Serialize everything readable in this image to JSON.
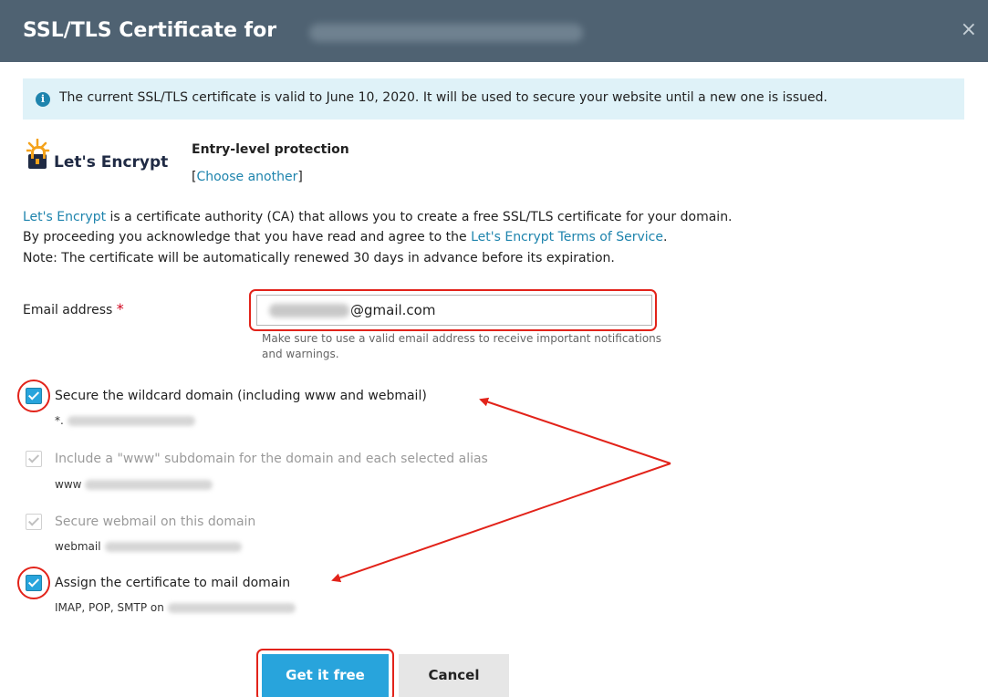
{
  "dialog": {
    "title": "SSL/TLS Certificate for",
    "close_glyph": "×"
  },
  "info": {
    "icon": "info-icon",
    "icon_glyph": "i",
    "text": "The current SSL/TLS certificate is valid to June 10, 2020. It will be used to secure your website until a new one is issued."
  },
  "provider": {
    "logo_text": "Let's Encrypt",
    "protection": "Entry-level protection",
    "choose_link": "Choose another",
    "bracket_open": "[",
    "bracket_close": "]"
  },
  "description": {
    "line1_link": "Let's Encrypt",
    "line1_rest": " is a certificate authority (CA) that allows you to create a free SSL/TLS certificate for your domain.",
    "line2_prefix": "By proceeding you acknowledge that you have read and agree to the ",
    "line2_link": "Let's Encrypt Terms of Service",
    "line2_suffix": ".",
    "line3": "Note: The certificate will be automatically renewed 30 days in advance before its expiration."
  },
  "email": {
    "label": "Email address",
    "required_mark": "*",
    "value": "@gmail.com",
    "hint": "Make sure to use a valid email address to receive important notifications and warnings."
  },
  "options": [
    {
      "label": "Secure the wildcard domain (including www and webmail)",
      "sub": "*.",
      "checked": true,
      "enabled": true
    },
    {
      "label": "Include a \"www\" subdomain for the domain and each selected alias",
      "sub": "www",
      "checked": true,
      "enabled": false
    },
    {
      "label": "Secure webmail on this domain",
      "sub": "webmail",
      "checked": true,
      "enabled": false
    },
    {
      "label": "Assign the certificate to mail domain",
      "sub": "IMAP, POP, SMTP on",
      "checked": true,
      "enabled": true
    }
  ],
  "buttons": {
    "primary": "Get it free",
    "secondary": "Cancel"
  },
  "colors": {
    "titlebar": "#4f6272",
    "accent": "#28a4dc",
    "link": "#1e84ad",
    "annotation": "#e2231a"
  }
}
